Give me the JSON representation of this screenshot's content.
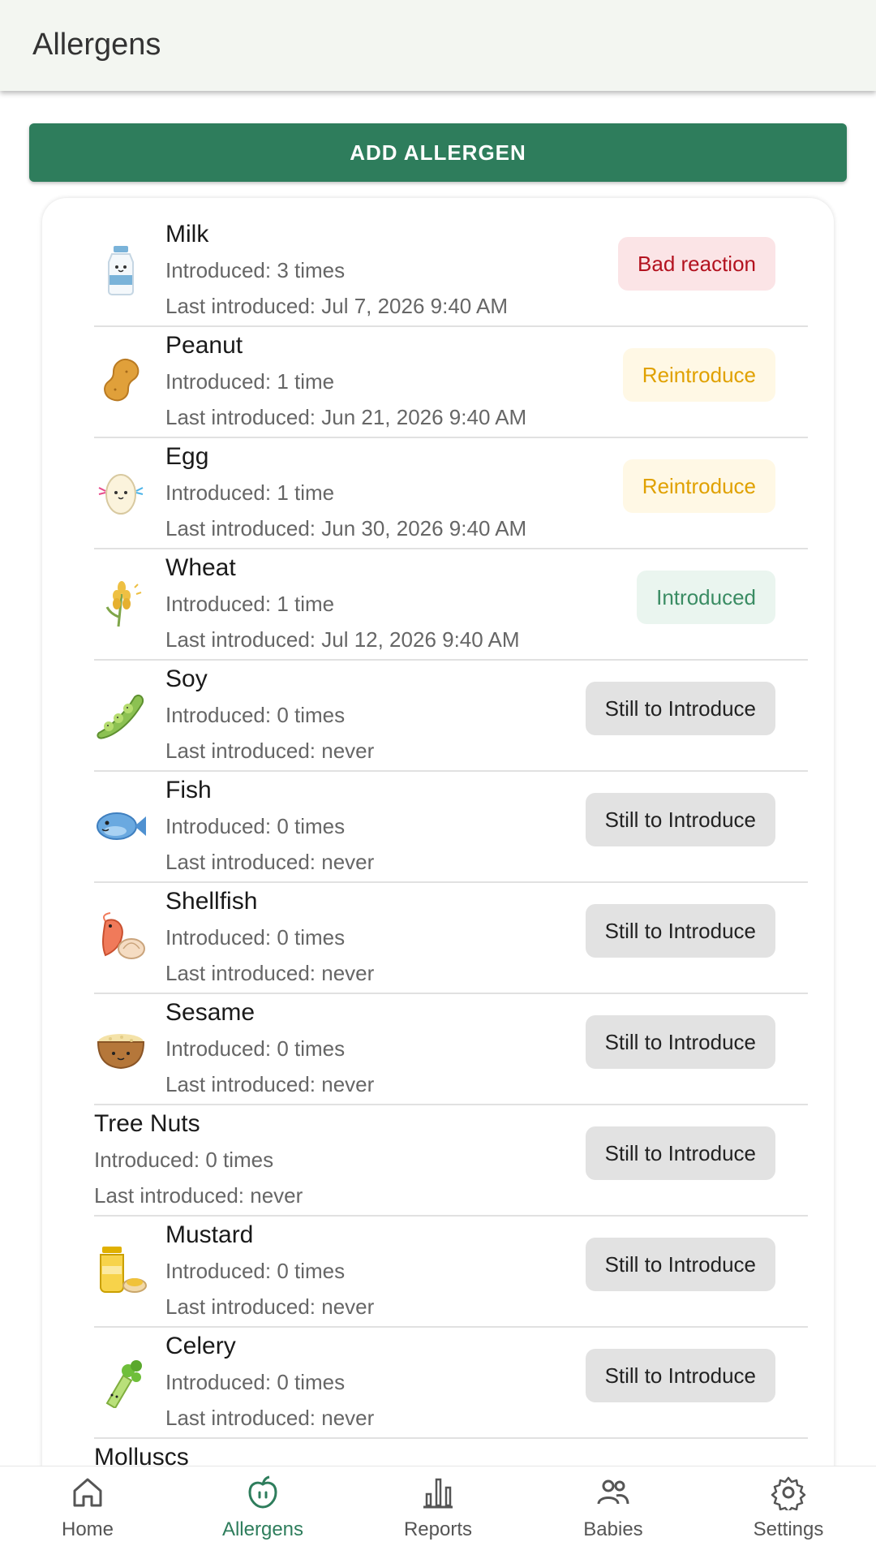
{
  "app_bar": {
    "title": "Allergens"
  },
  "add_button": {
    "label": "ADD ALLERGEN"
  },
  "allergens": [
    {
      "name": "Milk",
      "introduced": "Introduced: 3 times",
      "last": "Last introduced: Jul 7, 2026 9:40 AM",
      "status": "Bad reaction",
      "icon": "milk-bottle-icon"
    },
    {
      "name": "Peanut",
      "introduced": "Introduced: 1 time",
      "last": "Last introduced: Jun 21, 2026 9:40 AM",
      "status": "Reintroduce",
      "icon": "peanut-icon"
    },
    {
      "name": "Egg",
      "introduced": "Introduced: 1 time",
      "last": "Last introduced: Jun 30, 2026 9:40 AM",
      "status": "Reintroduce",
      "icon": "egg-icon"
    },
    {
      "name": "Wheat",
      "introduced": "Introduced: 1 time",
      "last": "Last introduced: Jul 12, 2026 9:40 AM",
      "status": "Introduced",
      "icon": "wheat-icon"
    },
    {
      "name": "Soy",
      "introduced": "Introduced: 0 times",
      "last": "Last introduced: never",
      "status": "Still to Introduce",
      "icon": "soybean-pod-icon"
    },
    {
      "name": "Fish",
      "introduced": "Introduced: 0 times",
      "last": "Last introduced: never",
      "status": "Still to Introduce",
      "icon": "fish-icon"
    },
    {
      "name": "Shellfish",
      "introduced": "Introduced: 0 times",
      "last": "Last introduced: never",
      "status": "Still to Introduce",
      "icon": "shrimp-shell-icon"
    },
    {
      "name": "Sesame",
      "introduced": "Introduced: 0 times",
      "last": "Last introduced: never",
      "status": "Still to Introduce",
      "icon": "sesame-bowl-icon"
    },
    {
      "name": "Tree Nuts",
      "introduced": "Introduced: 0 times",
      "last": "Last introduced: never",
      "status": "Still to Introduce",
      "icon": ""
    },
    {
      "name": "Mustard",
      "introduced": "Introduced: 0 times",
      "last": "Last introduced: never",
      "status": "Still to Introduce",
      "icon": "mustard-jar-icon"
    },
    {
      "name": "Celery",
      "introduced": "Introduced: 0 times",
      "last": "Last introduced: never",
      "status": "Still to Introduce",
      "icon": "celery-icon"
    },
    {
      "name": "Molluscs",
      "introduced": "",
      "last": "",
      "status": "",
      "icon": ""
    }
  ],
  "status_colors": {
    "Bad reaction": "#b3121f",
    "Reintroduce": "#e0a100",
    "Introduced": "#3a8c63",
    "Still to Introduce": "#222222"
  },
  "bottom_nav": [
    {
      "label": "Home",
      "icon": "home-icon"
    },
    {
      "label": "Allergens",
      "icon": "apple-icon",
      "active": true
    },
    {
      "label": "Reports",
      "icon": "bar-chart-icon"
    },
    {
      "label": "Babies",
      "icon": "people-icon"
    },
    {
      "label": "Settings",
      "icon": "gear-icon"
    }
  ],
  "accent_color": "#2e7d5c"
}
